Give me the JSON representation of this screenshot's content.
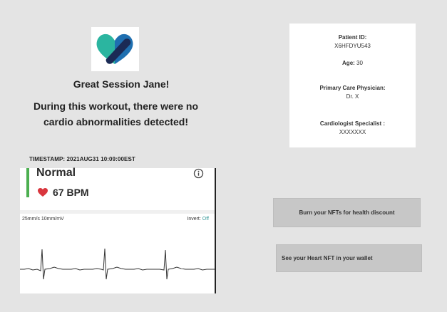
{
  "logo": {
    "icon": "heart-bandage-logo",
    "colors": [
      "#2bb5a0",
      "#1f5fa8",
      "#1b2a55"
    ]
  },
  "greeting": "Great Session Jane!",
  "message": "During this workout, there were no cardio abnormalities detected!",
  "timestamp": "TIMESTAMP: 2021AUG31 10:09:00EST",
  "ecg": {
    "status": "Normal",
    "status_color": "#4caf50",
    "bpm": "67 BPM",
    "heart_icon": "heart-icon",
    "info_icon": "info-icon",
    "scale": "25mm/s  10mm/mV",
    "invert_label": "Invert:",
    "invert_value": "Off"
  },
  "patient": {
    "id_label": "Patient ID:",
    "id_value": "X6HFDYU543",
    "age_label": "Age:",
    "age_value": "30",
    "physician_label": "Primary Care Physician:",
    "physician_value": "Dr. X",
    "cardiologist_label": "Cardiologist Specialist :",
    "cardiologist_value": "XXXXXXX"
  },
  "actions": {
    "burn_label": "Burn your NFTs for health discount",
    "wallet_label": "See your Heart NFT in your wallet"
  }
}
